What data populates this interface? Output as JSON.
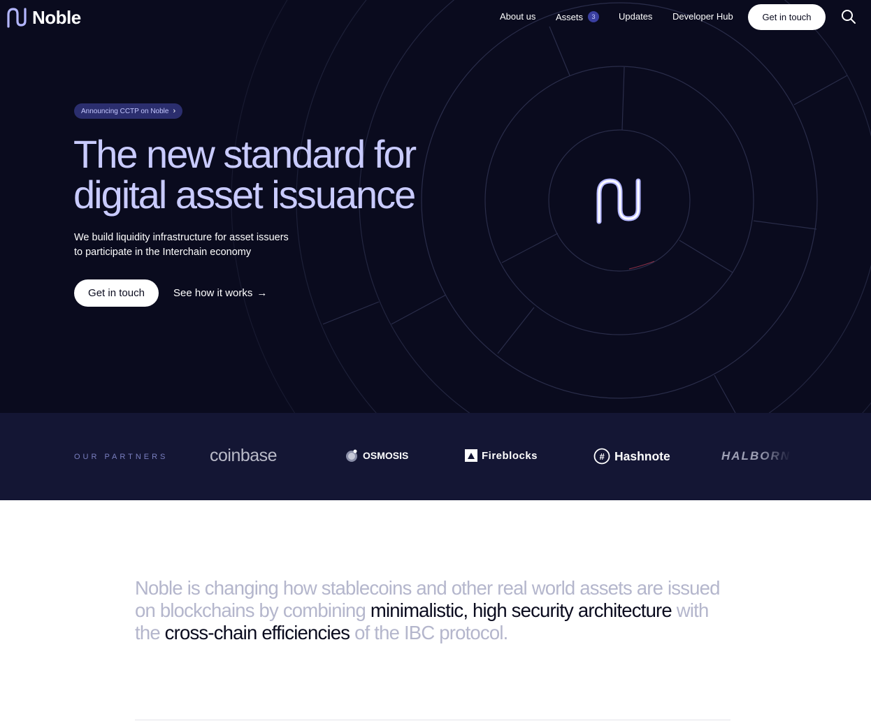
{
  "nav": {
    "brand": "Noble",
    "links": [
      "About us",
      "Assets",
      "Updates",
      "Developer Hub"
    ],
    "assets_badge": "3",
    "cta": "Get in touch",
    "search_icon": "search-icon"
  },
  "hero": {
    "announcement": "Announcing CCTP on Noble",
    "announcement_chevron": "›",
    "headline_line1": "The new standard for",
    "headline_line2": "digital asset issuance",
    "subhead_line1": "We build liquidity infrastructure for asset issuers",
    "subhead_line2": "to participate in the Interchain economy",
    "cta": "Get in touch",
    "secondary": "See how it works",
    "secondary_arrow": "→"
  },
  "partners": {
    "label": "OUR PARTNERS",
    "items": [
      "coinbase",
      "OSMOSIS",
      "Fireblocks",
      "Hashnote",
      "HALBORN"
    ]
  },
  "statement": {
    "seg1": "Noble is changing how stablecoins and other real world assets are issued on blockchains by combining ",
    "seg2": "minimalistic, high security architecture",
    "seg3": " with the ",
    "seg4": "cross-chain efficiencies",
    "seg5": " of the IBC protocol."
  },
  "colors": {
    "hero_bg": "#0a0b1e",
    "partners_bg": "#141634",
    "accent": "#c9cbff",
    "badge": "#3a3fa0"
  }
}
